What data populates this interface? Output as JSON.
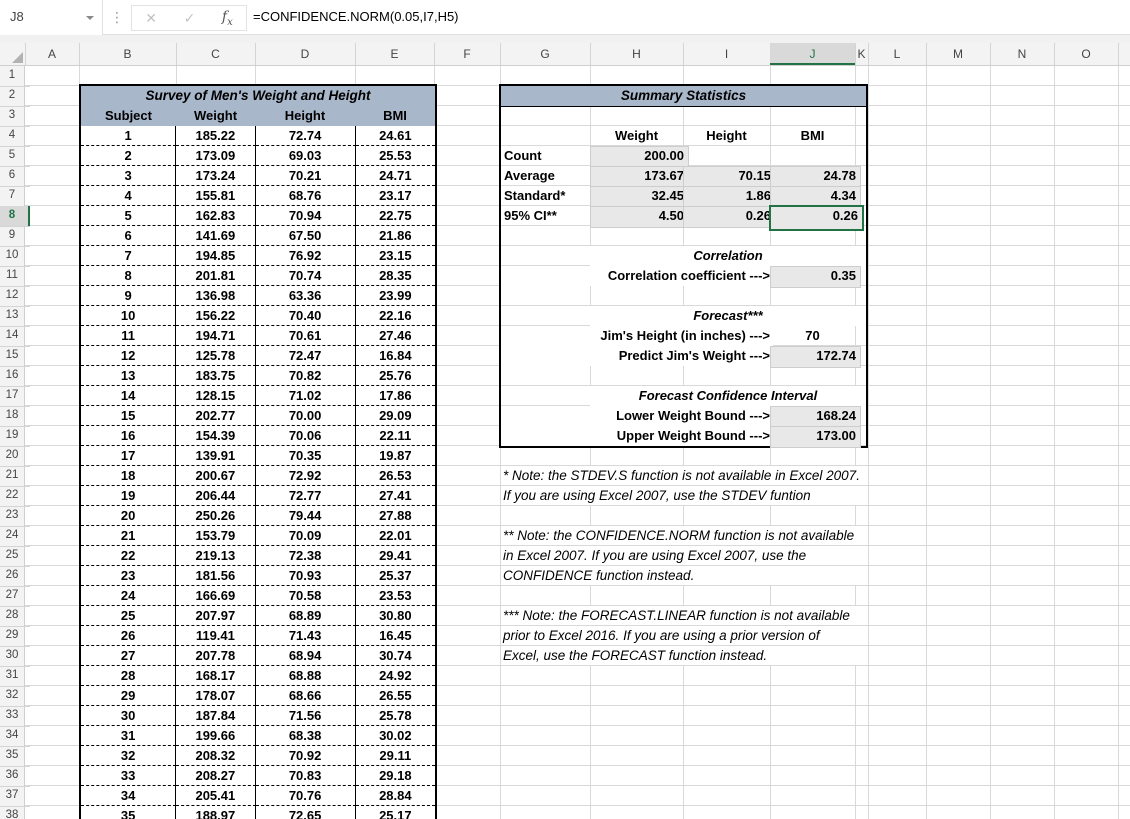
{
  "formula_bar": {
    "name_box": "J8",
    "formula": "=CONFIDENCE.NORM(0.05,I7,H5)",
    "cancel_icon": "✕",
    "enter_icon": "✓"
  },
  "grid": {
    "column_letters": [
      "A",
      "B",
      "C",
      "D",
      "E",
      "F",
      "G",
      "H",
      "I",
      "J",
      "K",
      "L",
      "M",
      "N",
      "O"
    ],
    "row_count": 38,
    "selected_cell": "J8",
    "selected_column": "J",
    "selected_row": 8
  },
  "survey_table": {
    "title": "Survey of Men's Weight and Height",
    "headers": [
      "Subject",
      "Weight",
      "Height",
      "BMI"
    ],
    "rows": [
      [
        "1",
        "185.22",
        "72.74",
        "24.61"
      ],
      [
        "2",
        "173.09",
        "69.03",
        "25.53"
      ],
      [
        "3",
        "173.24",
        "70.21",
        "24.71"
      ],
      [
        "4",
        "155.81",
        "68.76",
        "23.17"
      ],
      [
        "5",
        "162.83",
        "70.94",
        "22.75"
      ],
      [
        "6",
        "141.69",
        "67.50",
        "21.86"
      ],
      [
        "7",
        "194.85",
        "76.92",
        "23.15"
      ],
      [
        "8",
        "201.81",
        "70.74",
        "28.35"
      ],
      [
        "9",
        "136.98",
        "63.36",
        "23.99"
      ],
      [
        "10",
        "156.22",
        "70.40",
        "22.16"
      ],
      [
        "11",
        "194.71",
        "70.61",
        "27.46"
      ],
      [
        "12",
        "125.78",
        "72.47",
        "16.84"
      ],
      [
        "13",
        "183.75",
        "70.82",
        "25.76"
      ],
      [
        "14",
        "128.15",
        "71.02",
        "17.86"
      ],
      [
        "15",
        "202.77",
        "70.00",
        "29.09"
      ],
      [
        "16",
        "154.39",
        "70.06",
        "22.11"
      ],
      [
        "17",
        "139.91",
        "70.35",
        "19.87"
      ],
      [
        "18",
        "200.67",
        "72.92",
        "26.53"
      ],
      [
        "19",
        "206.44",
        "72.77",
        "27.41"
      ],
      [
        "20",
        "250.26",
        "79.44",
        "27.88"
      ],
      [
        "21",
        "153.79",
        "70.09",
        "22.01"
      ],
      [
        "22",
        "219.13",
        "72.38",
        "29.41"
      ],
      [
        "23",
        "181.56",
        "70.93",
        "25.37"
      ],
      [
        "24",
        "166.69",
        "70.58",
        "23.53"
      ],
      [
        "25",
        "207.97",
        "68.89",
        "30.80"
      ],
      [
        "26",
        "119.41",
        "71.43",
        "16.45"
      ],
      [
        "27",
        "207.78",
        "68.94",
        "30.74"
      ],
      [
        "28",
        "168.17",
        "68.88",
        "24.92"
      ],
      [
        "29",
        "178.07",
        "68.66",
        "26.55"
      ],
      [
        "30",
        "187.84",
        "71.56",
        "25.78"
      ],
      [
        "31",
        "199.66",
        "68.38",
        "30.02"
      ],
      [
        "32",
        "208.32",
        "70.92",
        "29.11"
      ],
      [
        "33",
        "208.27",
        "70.83",
        "29.18"
      ],
      [
        "34",
        "205.41",
        "70.76",
        "28.84"
      ],
      [
        "35",
        "188.97",
        "72.65",
        "25.17"
      ]
    ]
  },
  "summary": {
    "title": "Summary Statistics",
    "col_headers": [
      "Weight",
      "Height",
      "BMI"
    ],
    "rows": [
      {
        "label": "Count",
        "values": [
          "200.00",
          "",
          ""
        ]
      },
      {
        "label": "Average",
        "values": [
          "173.67",
          "70.15",
          "24.78"
        ]
      },
      {
        "label": "Standard*",
        "values": [
          "32.45",
          "1.86",
          "4.34"
        ]
      },
      {
        "label": "95% CI**",
        "values": [
          "4.50",
          "0.26",
          "0.26"
        ]
      }
    ]
  },
  "correlation": {
    "title": "Correlation",
    "label": "Correlation coefficient --->",
    "value": "0.35"
  },
  "forecast": {
    "title": "Forecast***",
    "rows": [
      {
        "label": "Jim's Height (in inches) --->",
        "value": "70"
      },
      {
        "label": "Predict Jim's Weight --->",
        "value": "172.74"
      }
    ]
  },
  "forecast_ci": {
    "title": "Forecast Confidence Interval",
    "rows": [
      {
        "label": "Lower Weight Bound --->",
        "value": "168.24"
      },
      {
        "label": "Upper Weight Bound --->",
        "value": "173.00"
      }
    ]
  },
  "notes": [
    [
      "* Note: the STDEV.S function is not available in Excel 2007.",
      "If you are using Excel 2007, use the STDEV funtion"
    ],
    [
      "** Note: the CONFIDENCE.NORM function is not available",
      "in Excel 2007. If you are using Excel 2007, use the",
      "CONFIDENCE function instead."
    ],
    [
      "*** Note: the FORECAST.LINEAR function is not available",
      "prior to Excel 2016. If you are using a prior version of",
      "Excel, use the FORECAST function instead."
    ]
  ],
  "colors": {
    "selection_green": "#217346",
    "table_header_blue": "#a9b7ca",
    "computed_cell_gray": "#e8e8e8"
  }
}
